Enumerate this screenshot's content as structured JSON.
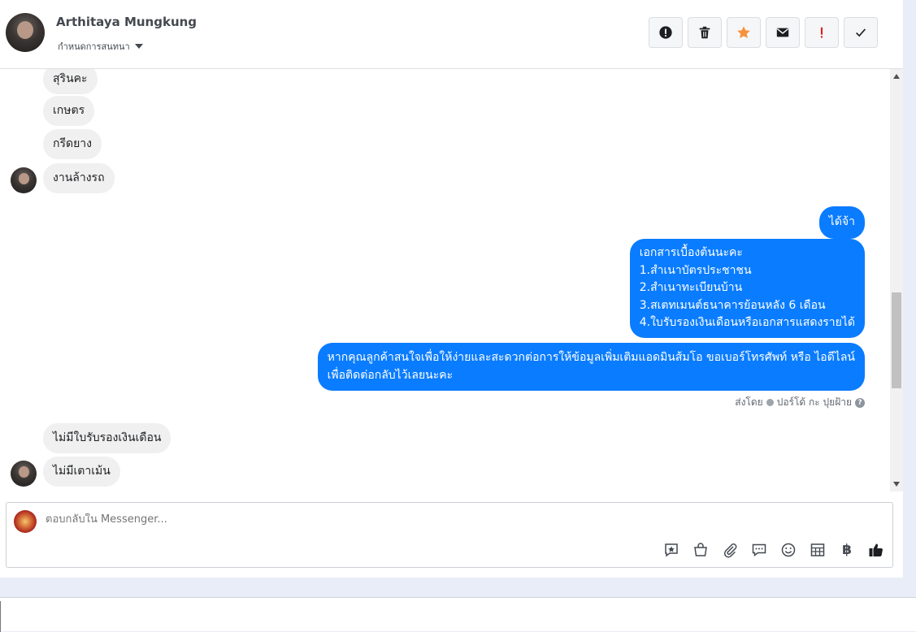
{
  "header": {
    "name": "Arthitaya Mungkung",
    "assign_label": "กำหนดการสนทนา",
    "actions": [
      {
        "icon": "exclamation-circle-icon"
      },
      {
        "icon": "trash-icon"
      },
      {
        "icon": "star-icon",
        "color": "#f7923a"
      },
      {
        "icon": "envelope-icon"
      },
      {
        "icon": "exclamation-icon",
        "color": "#e02020"
      },
      {
        "icon": "check-icon"
      }
    ]
  },
  "messages": {
    "incoming_top": [
      "สุรินคะ",
      "เกษตร",
      "กรีดยาง",
      "งานล้างรถ"
    ],
    "outgoing": [
      {
        "lines": [
          "ได้จ้า"
        ]
      },
      {
        "lines": [
          "เอกสารเบื้องต้นนะคะ",
          "1.สำเนาบัตรประชาชน",
          "2.สำเนาทะเบียนบ้าน",
          "3.สเตทเมนต์ธนาคารย้อนหลัง 6 เดือน",
          "4.ใบรับรองเงินเดือนหรือเอกสารแสดงรายได้"
        ]
      },
      {
        "lines": [
          "หากคุณลูกค้าสนใจเพื่อให้ง่ายและสะดวกต่อการให้ข้อมูลเพิ่มเติมแอดมินส้มโอ ขอเบอร์โทรศัพท์ หรือ ไอดีไลน์",
          "เพื่อติดต่อกลับไว้เลยนะคะ"
        ]
      }
    ],
    "sent_by_prefix": "ส่งโดย",
    "sent_by_name": "ปอร์โด้ กะ ปุยฝ้าย",
    "incoming_bottom": [
      "ไม่มีใบรับรองเงินเดือน",
      "ไม่มีเตาเม้น"
    ]
  },
  "composer": {
    "placeholder": "ตอบกลับใน Messenger...",
    "tools": [
      "saved-reply-icon",
      "shop-bag-icon",
      "paperclip-icon",
      "chat-bubble-icon",
      "emoji-icon",
      "table-icon",
      "baht-icon",
      "thumbs-up-icon"
    ],
    "baht_symbol": "฿"
  },
  "colors": {
    "outgoing_bubble": "#0a7cff",
    "incoming_bubble": "#f0f0f0",
    "star": "#f7923a",
    "alert": "#e02020"
  }
}
